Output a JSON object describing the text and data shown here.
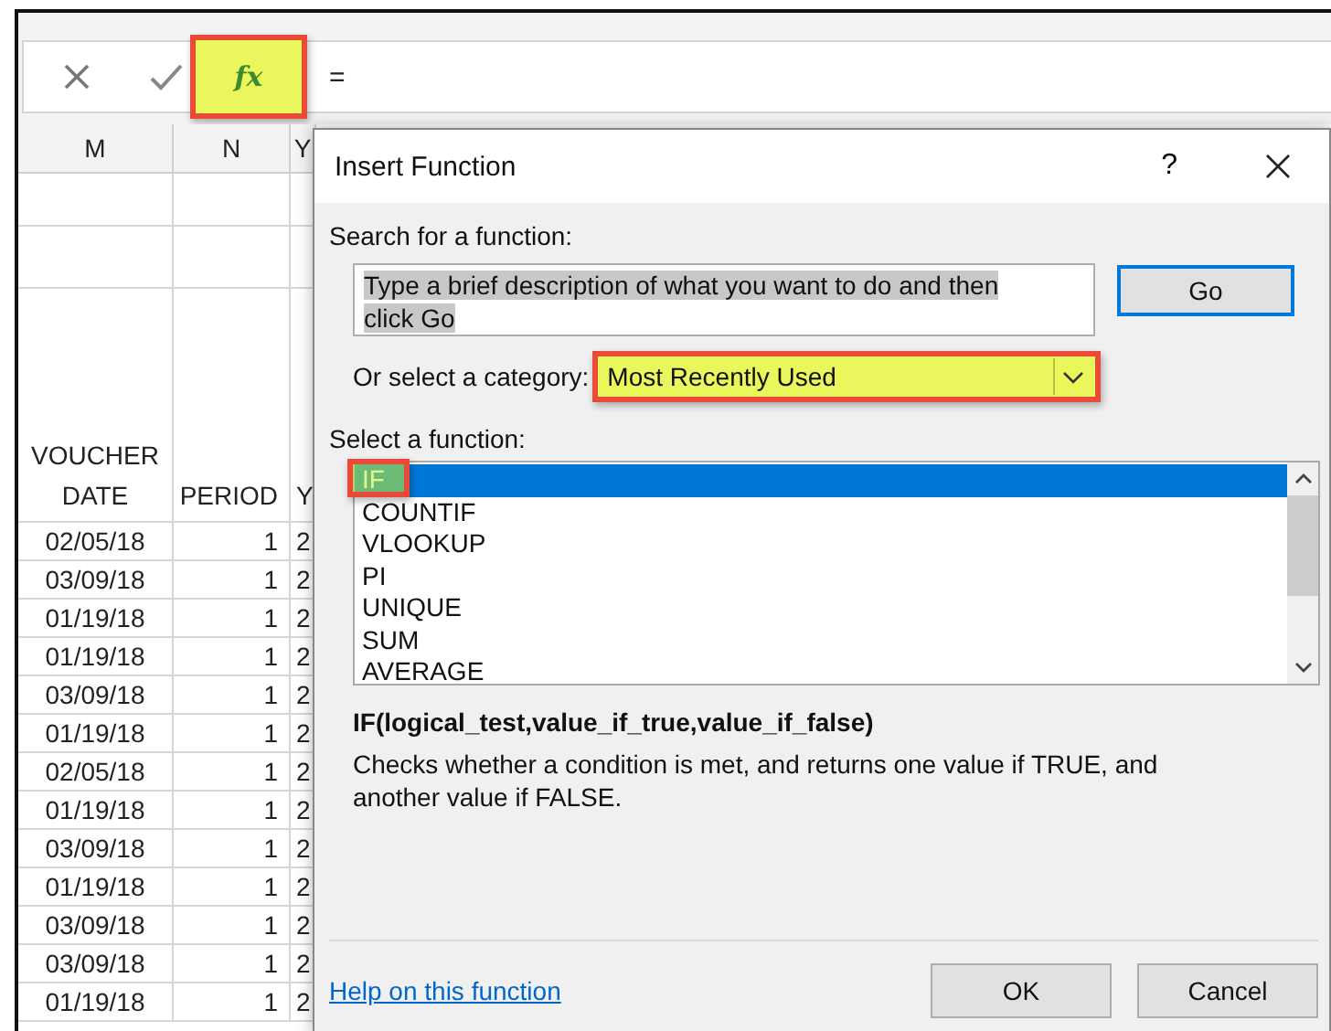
{
  "formula_bar": {
    "fx_button": {
      "label": "fx",
      "highlighted": true
    },
    "formula": "="
  },
  "sheet": {
    "columns": [
      "M",
      "N",
      "Y"
    ],
    "header": [
      "VOUCHER DATE",
      "PERIOD",
      "Y"
    ],
    "rows": [
      [
        "02/05/18",
        "1",
        "2"
      ],
      [
        "03/09/18",
        "1",
        "2"
      ],
      [
        "01/19/18",
        "1",
        "2"
      ],
      [
        "01/19/18",
        "1",
        "2"
      ],
      [
        "03/09/18",
        "1",
        "2"
      ],
      [
        "01/19/18",
        "1",
        "2"
      ],
      [
        "02/05/18",
        "1",
        "2"
      ],
      [
        "01/19/18",
        "1",
        "2"
      ],
      [
        "03/09/18",
        "1",
        "2"
      ],
      [
        "01/19/18",
        "1",
        "2"
      ],
      [
        "03/09/18",
        "1",
        "2"
      ],
      [
        "03/09/18",
        "1",
        "2"
      ],
      [
        "01/19/18",
        "1",
        "2"
      ]
    ]
  },
  "dialog": {
    "title": "Insert Function",
    "help": "?",
    "search_label": "Search for a function:",
    "search_value": "Type a brief description of what you want to do and then click Go",
    "go_button": "Go",
    "category_label": "Or select a category:",
    "category": {
      "value": "Most Recently Used",
      "highlighted": true
    },
    "function_label": "Select a function:",
    "functions": [
      {
        "name": "IF",
        "selected": true,
        "highlighted": true
      },
      {
        "name": "COUNTIF",
        "selected": false,
        "highlighted": false
      },
      {
        "name": "VLOOKUP",
        "selected": false,
        "highlighted": false
      },
      {
        "name": "PI",
        "selected": false,
        "highlighted": false
      },
      {
        "name": "UNIQUE",
        "selected": false,
        "highlighted": false
      },
      {
        "name": "SUM",
        "selected": false,
        "highlighted": false
      },
      {
        "name": "AVERAGE",
        "selected": false,
        "highlighted": false
      }
    ],
    "signature": "IF(logical_test,value_if_true,value_if_false)",
    "description": "Checks whether a condition is met, and returns one value if TRUE, and another value if FALSE.",
    "help_link": "Help on this function",
    "buttons": [
      "OK",
      "Cancel"
    ]
  }
}
